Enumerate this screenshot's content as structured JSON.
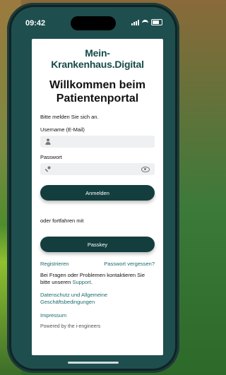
{
  "status_bar": {
    "time": "09:42"
  },
  "brand": "Mein-Krankenhaus.Digital",
  "welcome_line1": "Willkommen beim",
  "welcome_line2": "Patientenportal",
  "login_prompt": "Bitte melden Sie sich an.",
  "username": {
    "label": "Username (E-Mail)",
    "value": "",
    "placeholder": ""
  },
  "password": {
    "label": "Passwort",
    "value": "",
    "placeholder": ""
  },
  "login_button": "Anmelden",
  "alt_login_text": "oder fortfahren mit",
  "passkey_button": "Passkey",
  "register_link": "Registrieren",
  "forgot_password_link": "Passwort vergessen?",
  "help_text": "Bei Fragen oder Problemen kontaktieren Sie bitte unseren ",
  "support_link": "Support",
  "help_suffix": ".",
  "privacy_link_line1": "Datenschutz und Allgemeine",
  "privacy_link_line2": "Geschäftsbedingungen",
  "imprint_link": "Impressum",
  "powered_by": "Powered by the i-engineers",
  "colors": {
    "primary": "#143e3e",
    "link": "#1d6a6a",
    "screen_bg": "#1f4e4e"
  },
  "icons": {
    "username": "person-icon",
    "password": "key-icon",
    "show_password": "eye-icon"
  }
}
